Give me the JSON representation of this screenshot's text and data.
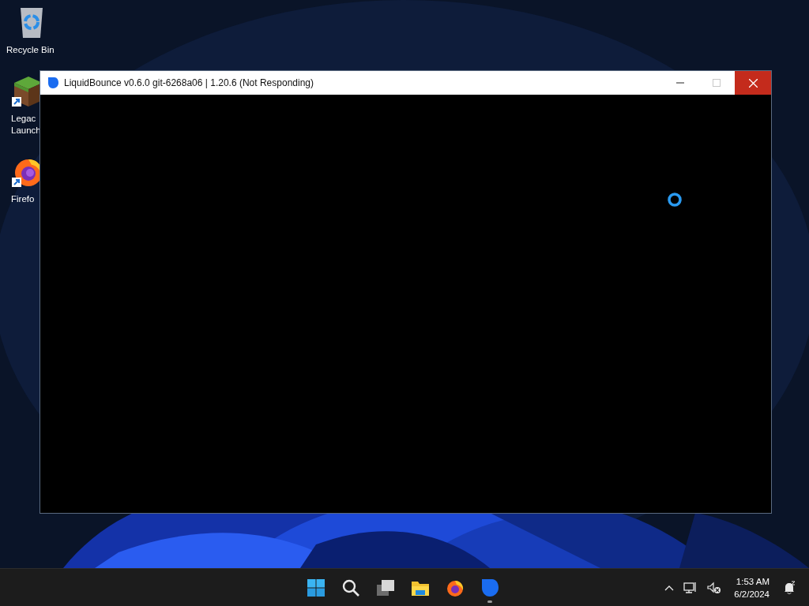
{
  "desktop": {
    "icons": [
      {
        "kind": "recycle-bin",
        "label_lines": [
          "Recycle Bin"
        ],
        "shortcut": false
      },
      {
        "kind": "block",
        "label_lines": [
          "Legac",
          "Launch"
        ],
        "shortcut": true
      },
      {
        "kind": "firefox",
        "label_lines": [
          "Firefo"
        ],
        "shortcut": true
      }
    ]
  },
  "window": {
    "title": "LiquidBounce v0.6.0 git-6268a06 | 1.20.6 (Not Responding)",
    "maximize_disabled": true
  },
  "taskbar": {
    "apps": [
      {
        "kind": "start",
        "running": false
      },
      {
        "kind": "search",
        "running": false
      },
      {
        "kind": "task-view",
        "running": false
      },
      {
        "kind": "explorer",
        "running": false
      },
      {
        "kind": "firefox",
        "running": false
      },
      {
        "kind": "liquidbounce",
        "running": true
      }
    ],
    "tray": {
      "time": "1:53 AM",
      "date": "6/2/2024",
      "volume_muted": true
    }
  }
}
